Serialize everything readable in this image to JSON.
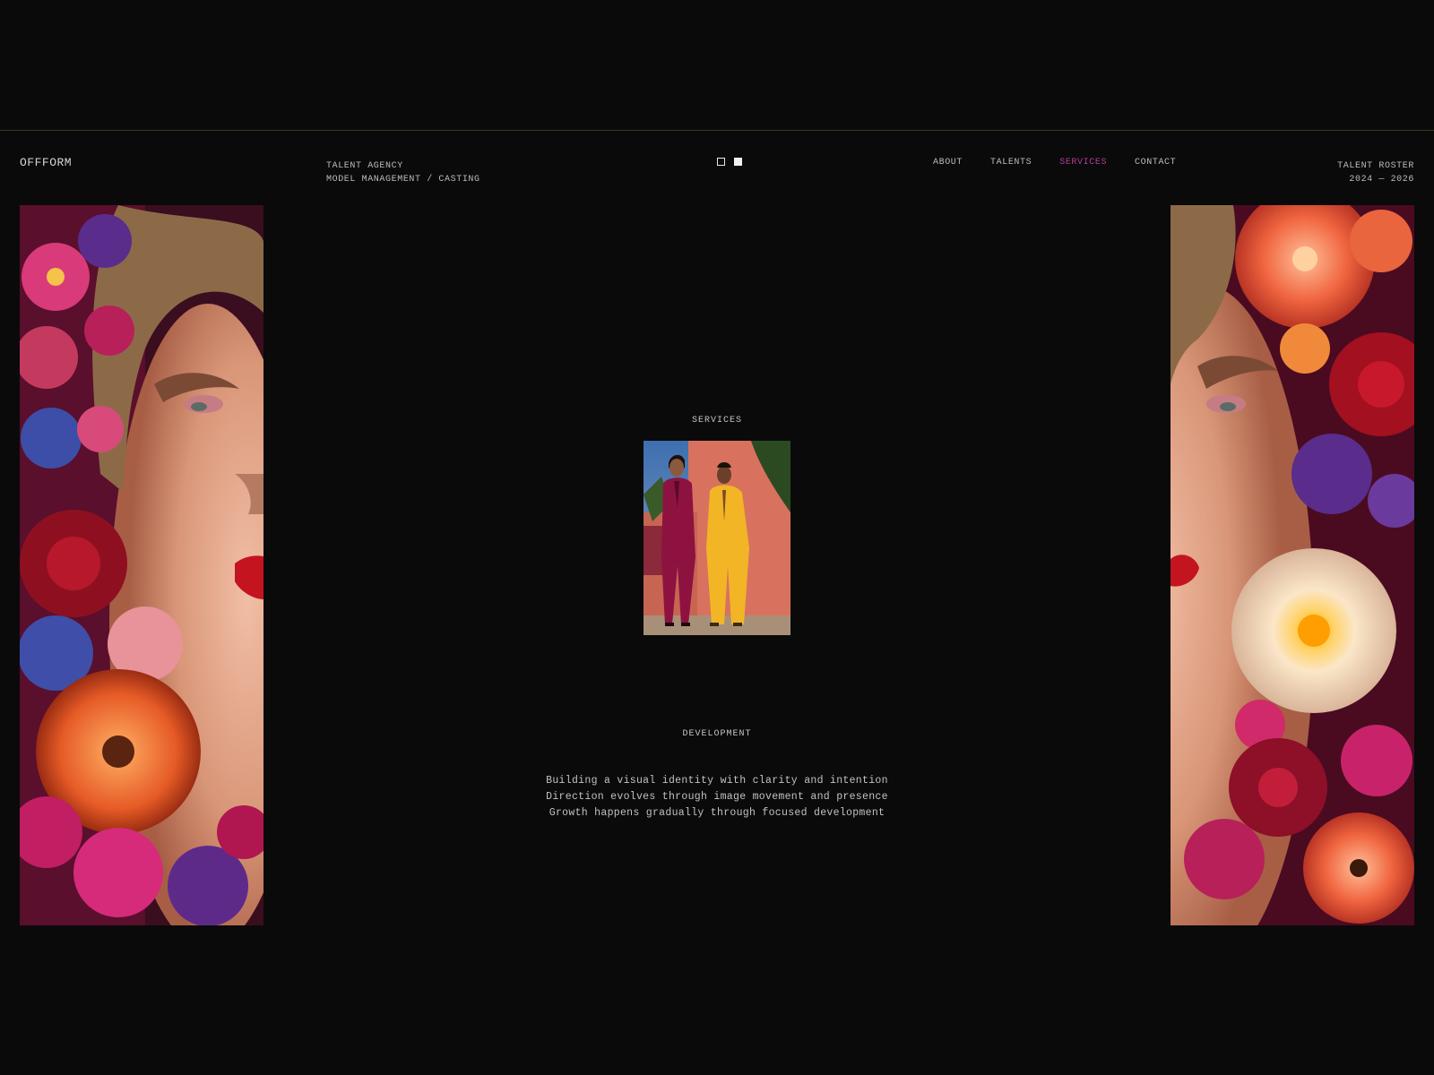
{
  "brand": {
    "logo": "OFFFORM"
  },
  "header": {
    "tagline_line1": "TALENT AGENCY",
    "tagline_line2": "MODEL MANAGEMENT / CASTING",
    "roster_line1": "TALENT ROSTER",
    "roster_line2": "2024 — 2026"
  },
  "nav": {
    "items": [
      {
        "label": "ABOUT",
        "active": false
      },
      {
        "label": "TALENTS",
        "active": false
      },
      {
        "label": "SERVICES",
        "active": true
      },
      {
        "label": "CONTACT",
        "active": false
      }
    ],
    "active_color": "#b13e9a"
  },
  "main": {
    "section_label": "SERVICES",
    "subsection_label": "DEVELOPMENT",
    "description": [
      "Building a visual identity with clarity and intention",
      "Direction evolves through image movement and presence",
      "Growth happens gradually through focused development"
    ]
  },
  "theme": {
    "background": "#0a0a0a",
    "text": "#c9c9c9"
  }
}
